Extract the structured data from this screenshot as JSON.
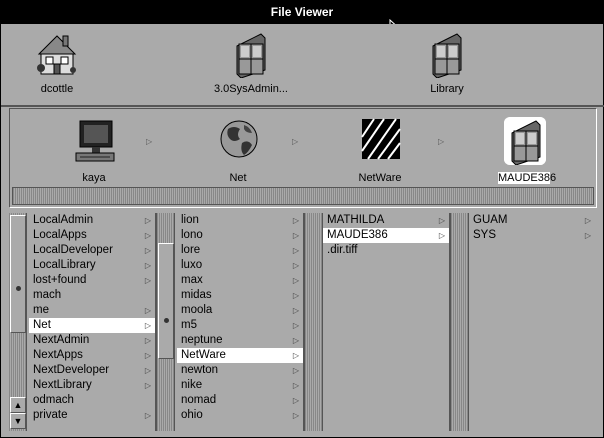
{
  "window": {
    "title": "File Viewer"
  },
  "shelf": [
    {
      "label": "dcottle",
      "icon": "house-icon"
    },
    {
      "label": "3.0SysAdmin...",
      "icon": "folder-icon"
    },
    {
      "label": "Library",
      "icon": "folder-icon"
    }
  ],
  "path": [
    {
      "label": "kaya",
      "icon": "computer-icon"
    },
    {
      "label": "Net",
      "icon": "globe-icon"
    },
    {
      "label": "NetWare",
      "icon": "netware-icon"
    },
    {
      "label": "MAUDE386",
      "icon": "folder-icon"
    }
  ],
  "columns": [
    {
      "items": [
        {
          "label": "LocalAdmin",
          "arrow": true
        },
        {
          "label": "LocalApps",
          "arrow": true
        },
        {
          "label": "LocalDeveloper",
          "arrow": true
        },
        {
          "label": "LocalLibrary",
          "arrow": true
        },
        {
          "label": "lost+found",
          "arrow": true
        },
        {
          "label": "mach",
          "arrow": false
        },
        {
          "label": "me",
          "arrow": true
        },
        {
          "label": "Net",
          "arrow": true,
          "selected": true
        },
        {
          "label": "NextAdmin",
          "arrow": true
        },
        {
          "label": "NextApps",
          "arrow": true
        },
        {
          "label": "NextDeveloper",
          "arrow": true
        },
        {
          "label": "NextLibrary",
          "arrow": true
        },
        {
          "label": "odmach",
          "arrow": false
        },
        {
          "label": "private",
          "arrow": true
        }
      ]
    },
    {
      "items": [
        {
          "label": "lion",
          "arrow": true
        },
        {
          "label": "lono",
          "arrow": true
        },
        {
          "label": "lore",
          "arrow": true
        },
        {
          "label": "luxo",
          "arrow": true
        },
        {
          "label": "max",
          "arrow": true
        },
        {
          "label": "midas",
          "arrow": true
        },
        {
          "label": "moola",
          "arrow": true
        },
        {
          "label": "m5",
          "arrow": true
        },
        {
          "label": "neptune",
          "arrow": true
        },
        {
          "label": "NetWare",
          "arrow": true,
          "selected": true
        },
        {
          "label": "newton",
          "arrow": true
        },
        {
          "label": "nike",
          "arrow": true
        },
        {
          "label": "nomad",
          "arrow": true
        },
        {
          "label": "ohio",
          "arrow": true
        }
      ]
    },
    {
      "items": [
        {
          "label": "MATHILDA",
          "arrow": true
        },
        {
          "label": "MAUDE386",
          "arrow": true,
          "selected": true
        },
        {
          "label": ".dir.tiff",
          "arrow": false
        }
      ]
    },
    {
      "items": [
        {
          "label": "GUAM",
          "arrow": true
        },
        {
          "label": "SYS",
          "arrow": true
        }
      ]
    }
  ]
}
